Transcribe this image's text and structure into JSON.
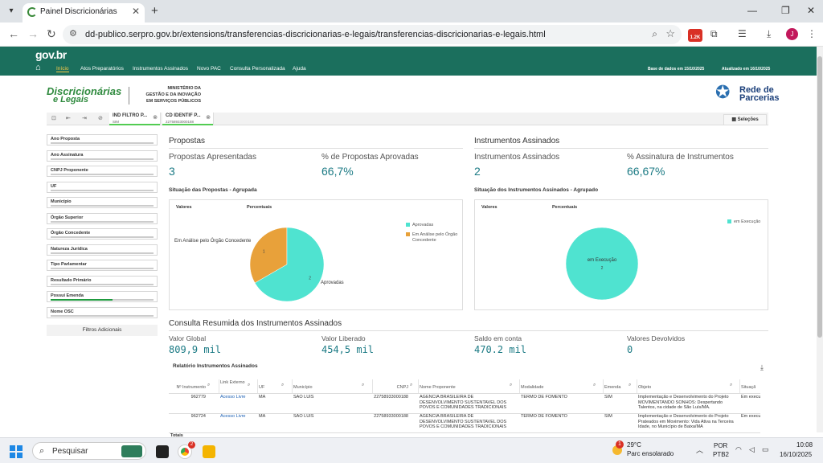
{
  "browser": {
    "tab_title": "Painel Discricionárias",
    "url": "dd-publico.serpro.gov.br/extensions/transferencias-discricionarias-e-legais/transferencias-discricionarias-e-legais.html",
    "ext_badge": "1.2K",
    "avatar_letter": "J"
  },
  "gov_header": {
    "logo": "gov.br",
    "nav": [
      "Início",
      "Atos Preparatórios",
      "Instrumentos Assinados",
      "Novo PAC",
      "Consulta Personalizada",
      "Ajuda"
    ],
    "base_info": "Base de dados em 15/10/2025",
    "updated_info": "Atualizado em 16/10/2025"
  },
  "branding": {
    "brand_line1": "Discricionárias",
    "brand_line2": "e Legais",
    "ministry": [
      "MINISTÉRIO DA",
      "GESTÃO E DA INOVAÇÃO",
      "EM SERVIÇOS PÚBLICOS"
    ],
    "partner_line1": "Rede de",
    "partner_line2": "Parcerias"
  },
  "selections": {
    "chips": [
      {
        "key": "IND FILTRO P...",
        "value": "SIM"
      },
      {
        "key": "CD IDENTIF P...",
        "value": "22758933000188"
      }
    ],
    "button": "Seleções"
  },
  "filters": [
    {
      "label": "Ano Proposta",
      "active": false
    },
    {
      "label": "Ano Assinatura",
      "active": false
    },
    {
      "label": "CNPJ Proponente",
      "active": false
    },
    {
      "label": "UF",
      "active": false
    },
    {
      "label": "Município",
      "active": false
    },
    {
      "label": "Órgão Superior",
      "active": false
    },
    {
      "label": "Órgão Concedente",
      "active": false
    },
    {
      "label": "Natureza Jurídica",
      "active": false
    },
    {
      "label": "Tipo Parlamentar",
      "active": false
    },
    {
      "label": "Resultado Primário",
      "active": false
    },
    {
      "label": "Possui Emenda",
      "active": true
    },
    {
      "label": "Nome OSC",
      "active": false
    }
  ],
  "filters_more": "Filtros Adicionais",
  "propostas": {
    "title": "Propostas",
    "kpi1_label": "Propostas Apresentadas",
    "kpi1_value": "3",
    "kpi2_label": "% de Propostas Aprovadas",
    "kpi2_value": "66,7%",
    "chart_title": "Situação das Propostas - Agrupada",
    "col_values": "Valores",
    "col_percent": "Percentuais"
  },
  "instrumentos": {
    "title": "Instrumentos Assinados",
    "kpi1_label": "Instrumentos Assinados",
    "kpi1_value": "2",
    "kpi2_label": "% Assinatura de Instrumentos",
    "kpi2_value": "66,67%",
    "chart_title": "Situação dos Instrumentos Assinados - Agrupado",
    "col_values": "Valores",
    "col_percent": "Percentuais"
  },
  "chart_data": [
    {
      "type": "pie",
      "title": "Situação das Propostas - Agrupada",
      "slices": [
        {
          "label": "Aprovadas",
          "value": 2,
          "color": "#4fe3d0"
        },
        {
          "label": "Em Análise pelo Órgão Concedente",
          "value": 1,
          "color": "#e8a13a"
        }
      ]
    },
    {
      "type": "pie",
      "title": "Situação dos Instrumentos Assinados - Agrupado",
      "slices": [
        {
          "label": "em Execução",
          "value": 2,
          "color": "#4fe3d0"
        }
      ]
    }
  ],
  "consulta": {
    "title": "Consulta Resumida dos Instrumentos Assinados",
    "valor_global_label": "Valor Global",
    "valor_global": "809,9 mil",
    "valor_liberado_label": "Valor Liberado",
    "valor_liberado": "454,5 mil",
    "saldo_label": "Saldo em conta",
    "saldo": "470.2 mil",
    "devolvidos_label": "Valores Devolvidos",
    "devolvidos": "0"
  },
  "relatorio": {
    "title": "Relatório Instrumentos Assinados",
    "headers": [
      "Nº Instrumento",
      "Link Externo",
      "UF",
      "Município",
      "CNPJ",
      "Nome Proponente",
      "Modalidade",
      "Emenda",
      "Objeto",
      "Situação"
    ],
    "rows": [
      [
        "962779",
        "Acesso Livre",
        "MA",
        "SÃO LUIS",
        "22758933000188",
        "AGENCIA BRASILEIRA DE DESENVOLVIMENTO SUSTENTAVEL DOS POVOS E COMUNIDADES TRADICIONAIS",
        "TERMO DE FOMENTO",
        "SIM",
        "Implementação e Desenvolvimento do Projeto MOVIMENTANDO SONHOS: Despertando Talentos, na cidade de São Luís/MA.",
        "Em execu"
      ],
      [
        "962724",
        "Acesso Livre",
        "MA",
        "SÃO LUIS",
        "22758933000188",
        "AGENCIA BRASILEIRA DE DESENVOLVIMENTO SUSTENTAVEL DOS POVOS E COMUNIDADES TRADICIONAIS",
        "TERMO DE FOMENTO",
        "SIM",
        "Implementação e Desenvolvimento do Projeto Prateados em Movimento: Vida Ativa na Terceira Idade, no Município de Baixa/MA",
        "Em execu"
      ]
    ],
    "footer": "Totais"
  },
  "taskbar": {
    "search_placeholder": "Pesquisar",
    "app_badge": "2",
    "weather_badge": "1",
    "temperature": "29°C",
    "weather": "Parc ensolarado",
    "lang1": "POR",
    "lang2": "PTB2",
    "time": "10:08",
    "date": "16/10/2025"
  }
}
